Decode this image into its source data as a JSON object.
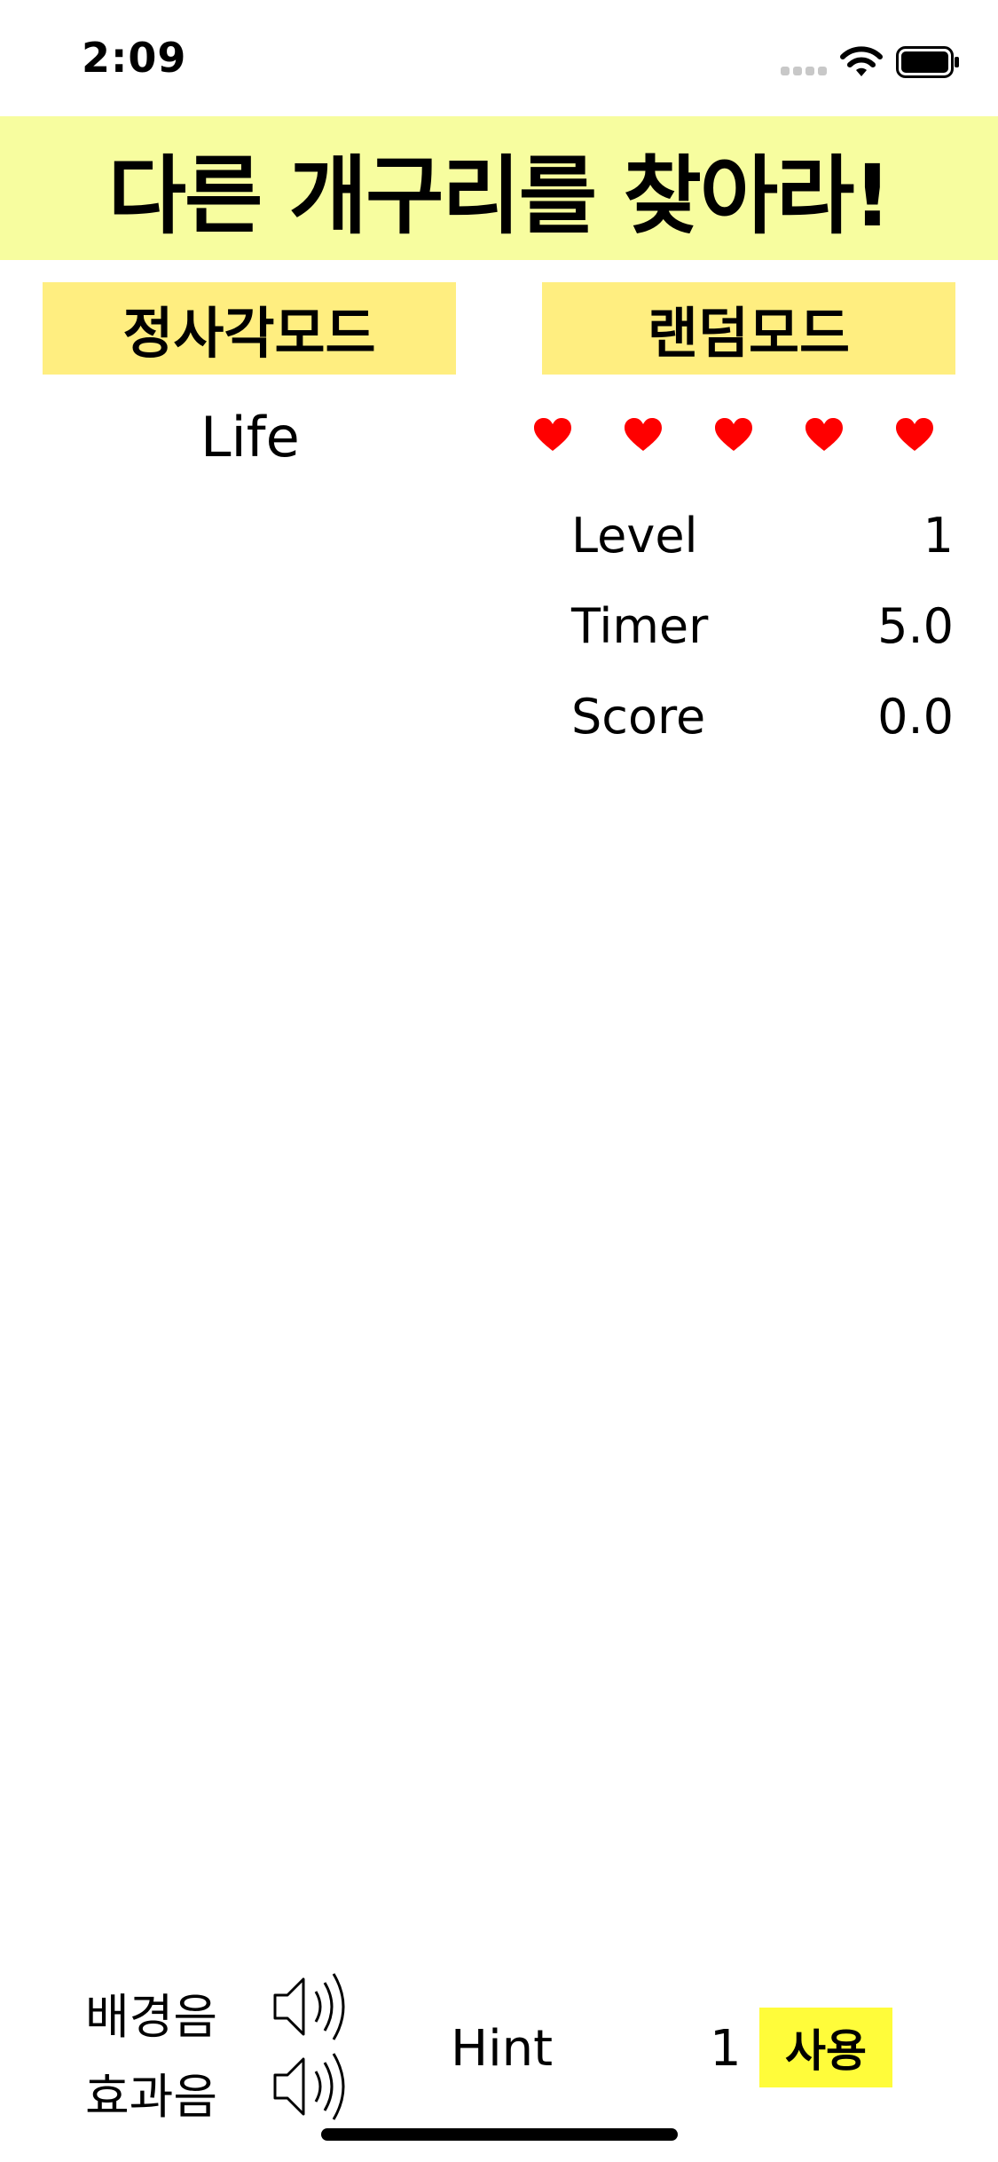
{
  "status_bar": {
    "time": "2:09"
  },
  "title": "다른 개구리를 찾아라!",
  "modes": {
    "square_label": "정사각모드",
    "random_label": "랜덤모드"
  },
  "life": {
    "label": "Life",
    "hearts": 5,
    "heart_color": "#ff0000"
  },
  "stats": {
    "level_label": "Level",
    "level_value": "1",
    "timer_label": "Timer",
    "timer_value": "5.0",
    "score_label": "Score",
    "score_value": "0.0"
  },
  "sound": {
    "bgm_label": "배경음",
    "sfx_label": "효과음",
    "icon": "speaker-icon"
  },
  "hint": {
    "label": "Hint",
    "count": "1",
    "use_label": "사용"
  },
  "colors": {
    "title_bg": "#f7fd9f",
    "mode_button_bg": "#ffee80",
    "use_button_bg": "#fffc3a"
  }
}
